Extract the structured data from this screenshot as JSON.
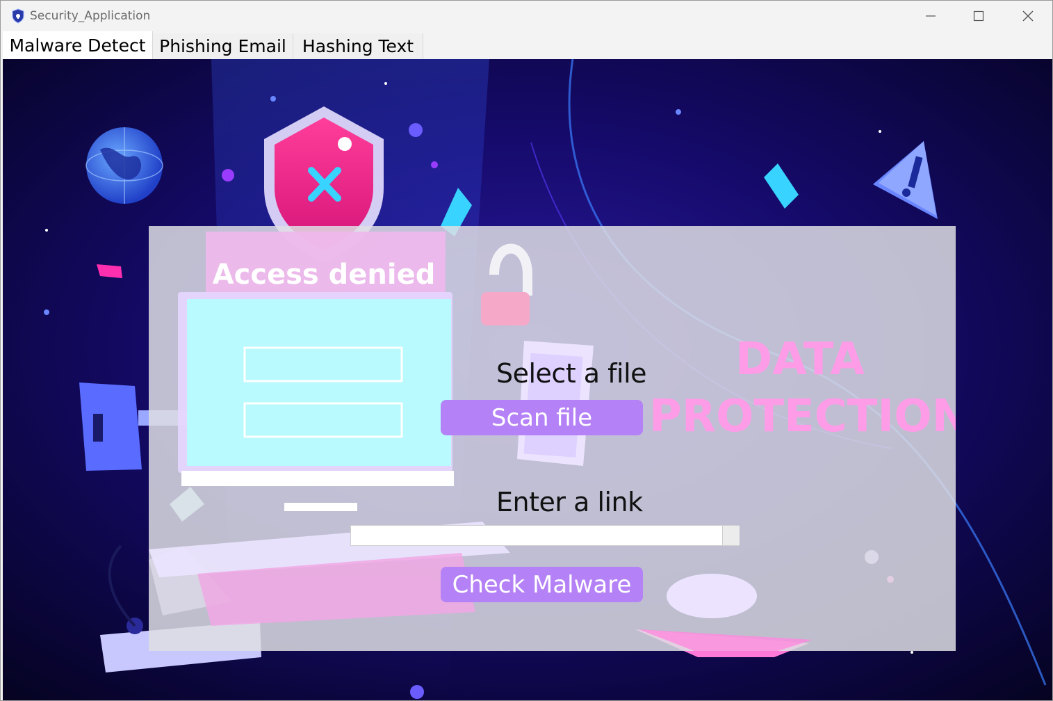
{
  "window": {
    "title": "Security_Application",
    "controls": {
      "minimize": "minimize-icon",
      "maximize": "maximize-icon",
      "close": "close-icon"
    }
  },
  "tabs": [
    {
      "label": "Malware Detect",
      "active": true
    },
    {
      "label": "Phishing Email",
      "active": false
    },
    {
      "label": "Hashing Text",
      "active": false
    }
  ],
  "background": {
    "banner": "Access denied",
    "headline_line1": "DATA",
    "headline_line2": "PROTECTION"
  },
  "malware_panel": {
    "select_label": "Select a file",
    "scan_button": "Scan file",
    "link_label": "Enter a link",
    "link_value": "",
    "check_button": "Check Malware"
  },
  "colors": {
    "button": "#b581f6",
    "background_dark": "#0a0630",
    "accent_pink": "#ff2fb0"
  }
}
